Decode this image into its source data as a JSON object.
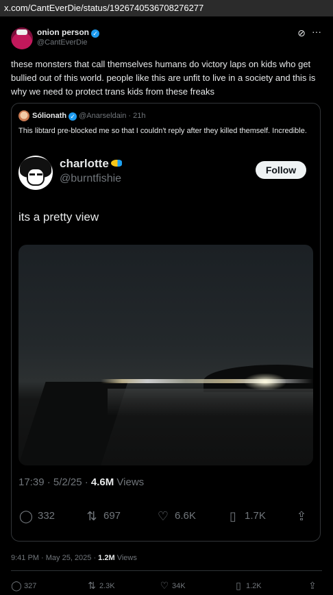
{
  "browser": {
    "url": "x.com/CantEverDie/status/1926740536708276277"
  },
  "post": {
    "author_name": "onion person",
    "author_handle": "@CantEverDie",
    "text": "these monsters that call themselves humans do victory laps on kids who get bullied out of this world.  people like this are unfit to live in a society and this is why we need to protect trans kids from these freaks",
    "time": "9:41 PM · May 25, 2025 · ",
    "views_count": "1.2M",
    "views_label": " Views",
    "replies": "327",
    "reposts": "2.3K",
    "likes": "34K",
    "bookmarks": "1.2K"
  },
  "quote": {
    "author_name": "Sólionath",
    "author_handle": "@Anarseldain · 21h",
    "text": "This libtard pre-blocked me so that I couldn't reply after they killed themself. Incredible.",
    "screenshot": {
      "name": "charlotte",
      "handle": "@burntfishie",
      "follow_label": "Follow",
      "text": "its a pretty view",
      "meta": "17:39 · 5/2/25 · ",
      "views_count": "4.6M",
      "views_label": " Views",
      "replies": "332",
      "reposts": "697",
      "likes": "6.6K",
      "bookmarks": "1.7K"
    }
  },
  "icons": {
    "verified": "verified-badge-icon",
    "grok": "grok-icon",
    "more": "more-icon",
    "reply": "reply-icon",
    "repost": "repost-icon",
    "like": "like-icon",
    "bookmark": "bookmark-icon",
    "share": "share-icon"
  },
  "colors": {
    "background": "#000000",
    "text": "#e7e9ea",
    "muted": "#71767b",
    "verified": "#1d9bf0",
    "border": "#333639"
  }
}
